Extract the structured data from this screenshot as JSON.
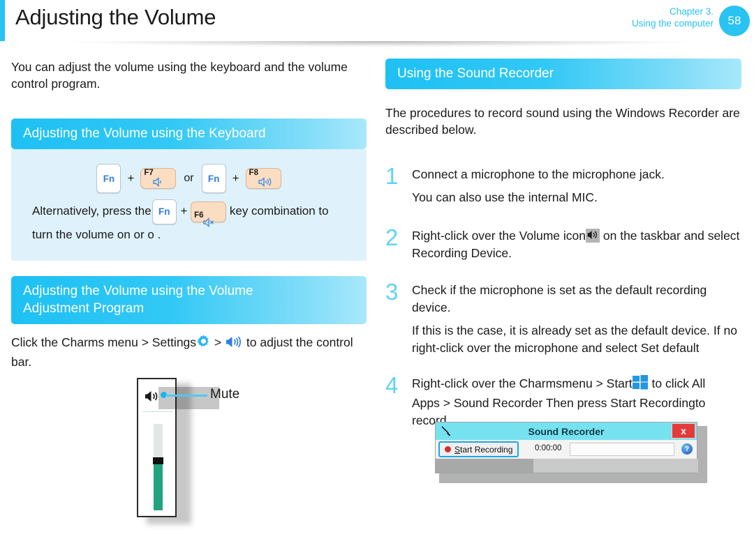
{
  "header": {
    "title": "Adjusting the Volume",
    "chapter": "Chapter 3.",
    "chapter_sub": "Using the computer",
    "page_number": "58",
    "accent_color": "#29c3f2"
  },
  "left": {
    "intro": "You can adjust the volume using the keyboard and the volume control program.",
    "section1_title": "Adjusting the Volume using the Keyboard",
    "keys": {
      "fn1": "Fn",
      "plus1": "+",
      "f7_label": "F7",
      "or": "or",
      "fn2": "Fn",
      "plus2": "+",
      "f8_label": "F8",
      "fn3": "Fn",
      "plus3": "+",
      "f6_label": "F6"
    },
    "note_part1": "Alternatively, press the",
    "note_part2": "key combination to",
    "note_line2": "turn the volume on or o .",
    "section2_title_line1": "Adjusting the Volume using the Volume",
    "section2_title_line2": "Adjustment Program",
    "charms_part1": "Click the Charms menu > Settings",
    "charms_sep": ">",
    "charms_part2": "to adjust the control",
    "charms_line2": "bar.",
    "mute_label": "Mute"
  },
  "right": {
    "section_title": "Using the Sound Recorder",
    "intro_line1": "The procedures to record sound using the Windows Recorder are",
    "intro_line2": "described below.",
    "steps": [
      {
        "number": "1",
        "text": "Connect a microphone to the microphone jack.",
        "sub": "You can also use the internal MIC."
      },
      {
        "number": "2",
        "text_part1": "Right-click over the Volume icon",
        "text_part2": "on the taskbar and select",
        "text_line2": "Recording Device."
      },
      {
        "number": "3",
        "text_line1": "Check if the microphone is set as the default recording",
        "text_line2": "device.",
        "sub_line1": "If this is the case, it is already set as the default device. If no",
        "sub_line2": "right-click over the microphone and select Set default"
      },
      {
        "number": "4",
        "text_part1": "Right-click over the Charms",
        "text_part2": "menu > Start",
        "text_part3": "to click All",
        "text_line2a": "Apps > Sound Recorder Then press Start Recording",
        "text_line2b": "to",
        "text_line3": "record."
      }
    ],
    "recorder": {
      "title": "Sound Recorder",
      "close_label": "x",
      "start_label_first": "S",
      "start_label_rest": "tart Recording",
      "time": "0:00:00",
      "help_label": "?"
    }
  }
}
